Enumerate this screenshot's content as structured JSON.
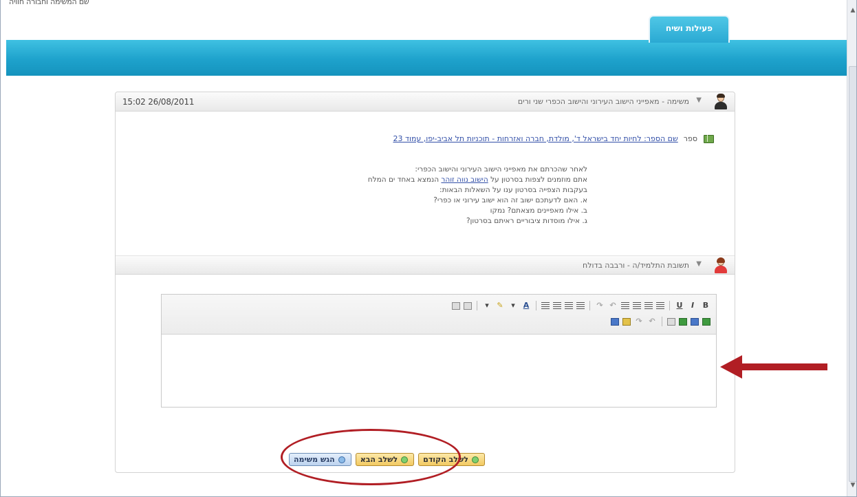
{
  "window": {
    "title": "שם המשימה וחבורה חוויה"
  },
  "tab": {
    "label": "פעילות ושיח"
  },
  "task_section": {
    "title": "משימה - מאפייני הישוב העירוני והישוב הכפרי שני ורים",
    "date": "15:02 26/08/2011",
    "book": {
      "label": "ספר",
      "link_text": "שם הספר: לחיות יחד בישראל ד', מולדת, חברה ואזרחות - תוכניות תל אביב-יפו, עמוד 23"
    },
    "text_lines": [
      "לאחר שהכרתם את מאפייני הישוב העירוני והישוב הכפרי:",
      "בעקבות הצפייה בסרטון ענו על השאלות הבאות:",
      "א. האם לדעתכם ישוב זה הוא ישוב עירוני או כפרי?",
      "ב. אילו מאפיינים מצאתם? נמקו",
      "ג. אילו מוסדות ציבוריים ראיתם בסרטון?"
    ],
    "line2_prefix": "אתם מוזמנים לצפות בסרטון על ",
    "line2_link": "הישוב נווה זוהר",
    "line2_suffix": " הנמצא באחד ים המלח"
  },
  "answer_section": {
    "title": "תשובת התלמיד/ה - ורבבה בדולח"
  },
  "toolbar": {
    "row1": {
      "bold": "B",
      "italic": "I",
      "underline": "U",
      "undo": "↶",
      "redo": "↷",
      "font_color": "A",
      "bg_color": "✎",
      "dropdown_caret": "▾"
    }
  },
  "buttons": {
    "prev": "לשלב הקודם",
    "next": "לשלב הבא",
    "submit": "הגש משימה"
  },
  "colors": {
    "header": "#1ea2cc",
    "annotation": "#b11e24",
    "link": "#3350a8"
  }
}
